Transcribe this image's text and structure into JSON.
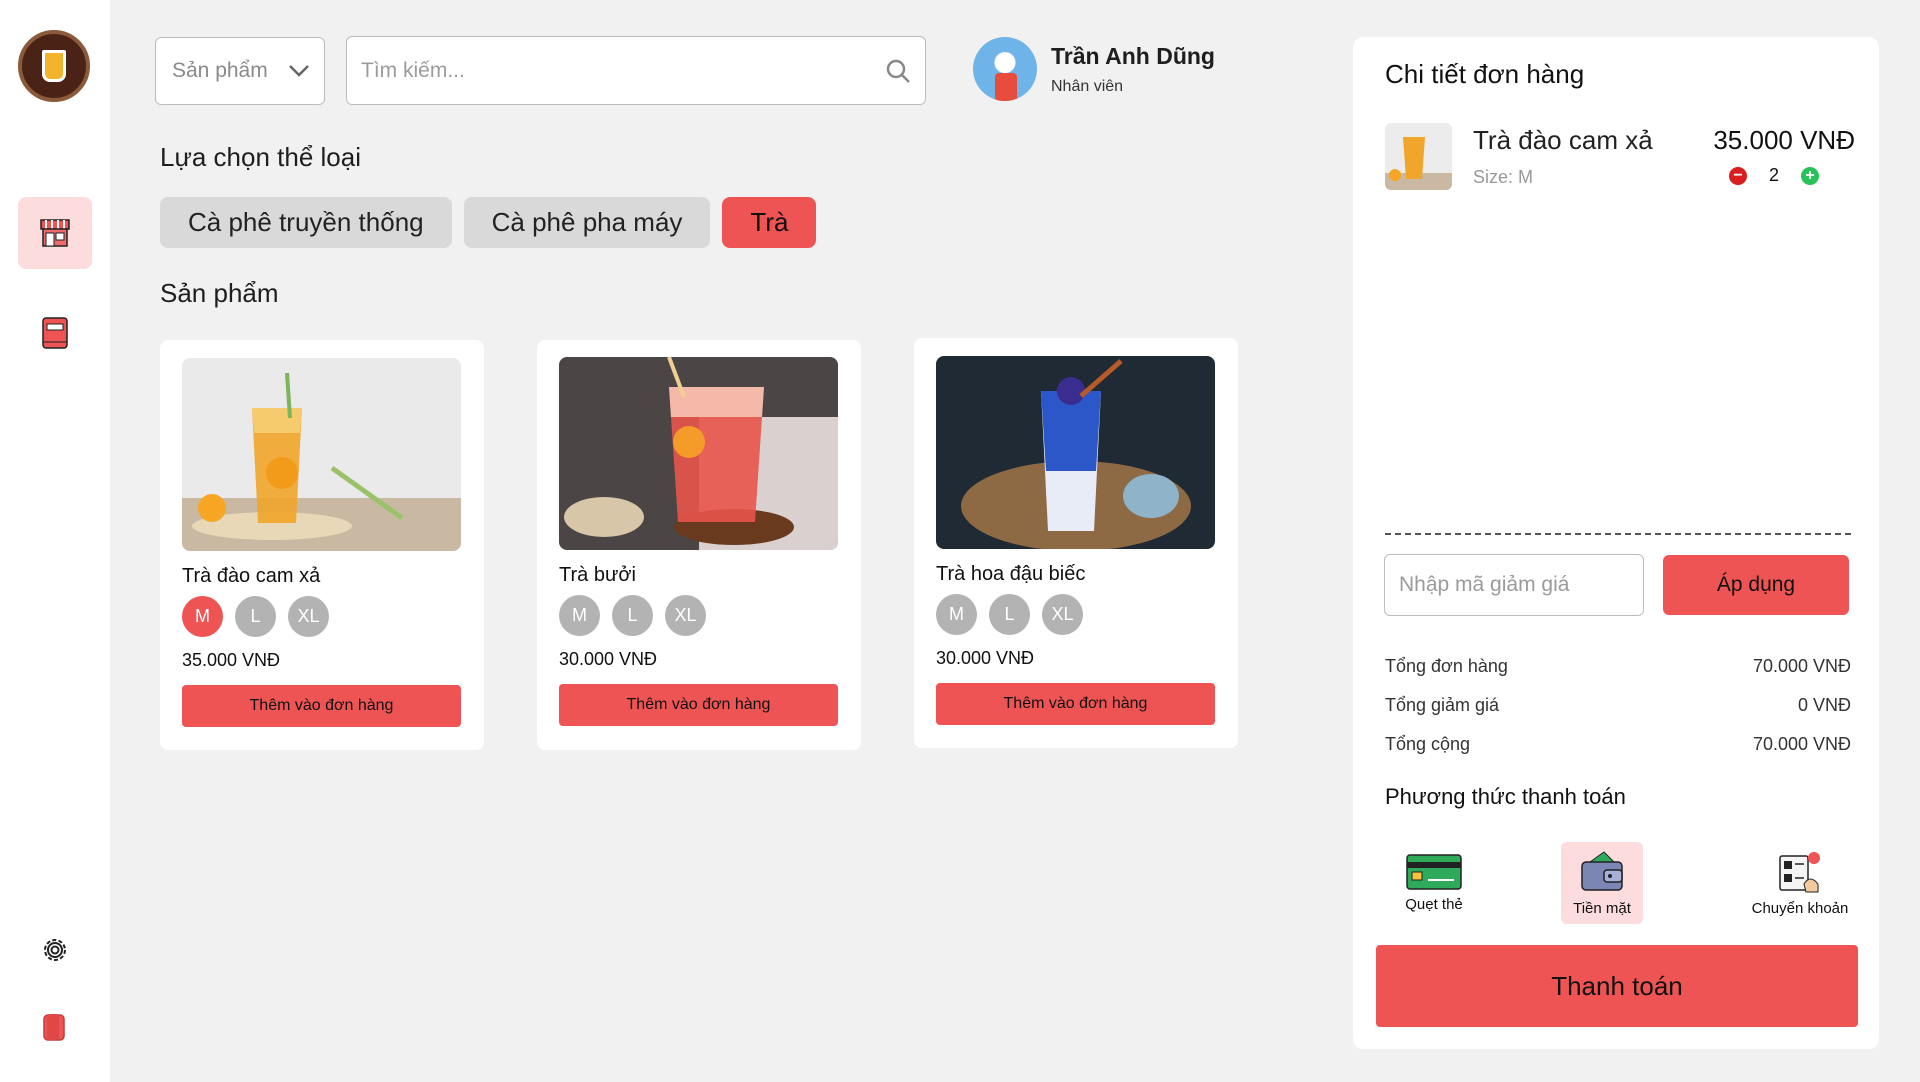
{
  "sidebar": {
    "items": [
      {
        "icon": "store-icon",
        "active": true
      },
      {
        "icon": "receipt-book-icon",
        "active": false
      },
      {
        "icon": "gear-icon",
        "active": false
      },
      {
        "icon": "logout-icon",
        "active": false
      }
    ]
  },
  "header": {
    "category_select": "Sản phẩm",
    "search_placeholder": "Tìm kiếm...",
    "user_name": "Trần Anh Dũng",
    "user_role": "Nhân viên"
  },
  "categories": {
    "title": "Lựa chọn thể loại",
    "items": [
      {
        "label": "Cà phê truyền thống",
        "active": false
      },
      {
        "label": "Cà phê pha máy",
        "active": false
      },
      {
        "label": "Trà",
        "active": true
      }
    ]
  },
  "products": {
    "title": "Sản phẩm",
    "items": [
      {
        "name": "Trà đào cam xả",
        "sizes": [
          "M",
          "L",
          "XL"
        ],
        "selected_size": "M",
        "price": "35.000 VNĐ",
        "add_label": "Thêm vào đơn hàng"
      },
      {
        "name": "Trà bưởi",
        "sizes": [
          "M",
          "L",
          "XL"
        ],
        "selected_size": "",
        "price": "30.000 VNĐ",
        "add_label": "Thêm vào đơn hàng"
      },
      {
        "name": "Trà hoa đậu biếc",
        "sizes": [
          "M",
          "L",
          "XL"
        ],
        "selected_size": "",
        "price": "30.000 VNĐ",
        "add_label": "Thêm vào đơn hàng"
      }
    ]
  },
  "order": {
    "title": "Chi tiết đơn hàng",
    "items": [
      {
        "name": "Trà đào cam xả",
        "size": "Size: M",
        "price": "35.000 VNĐ",
        "qty": "2",
        "minus": "−",
        "plus": "+"
      }
    ],
    "coupon_placeholder": "Nhập mã giảm giá",
    "apply_label": "Áp dụng",
    "summary": [
      {
        "label": "Tổng đơn hàng",
        "value": "70.000 VNĐ"
      },
      {
        "label": "Tổng giảm giá",
        "value": "0 VNĐ"
      },
      {
        "label": "Tổng cộng",
        "value": "70.000 VNĐ"
      }
    ],
    "payment_title": "Phương thức thanh toán",
    "payment_methods": [
      {
        "label": "Quẹt thẻ",
        "icon": "credit-card-icon",
        "active": false
      },
      {
        "label": "Tiền mặt",
        "icon": "wallet-icon",
        "active": true
      },
      {
        "label": "Chuyển khoản",
        "icon": "bank-transfer-icon",
        "active": false
      }
    ],
    "checkout_label": "Thanh toán"
  },
  "colors": {
    "accent": "#ef5454",
    "accent_light": "#fcdcdc",
    "background": "#f1f1f1",
    "size_inactive": "#b3b3b3",
    "minus": "#d81e1e",
    "plus": "#27c35a"
  }
}
